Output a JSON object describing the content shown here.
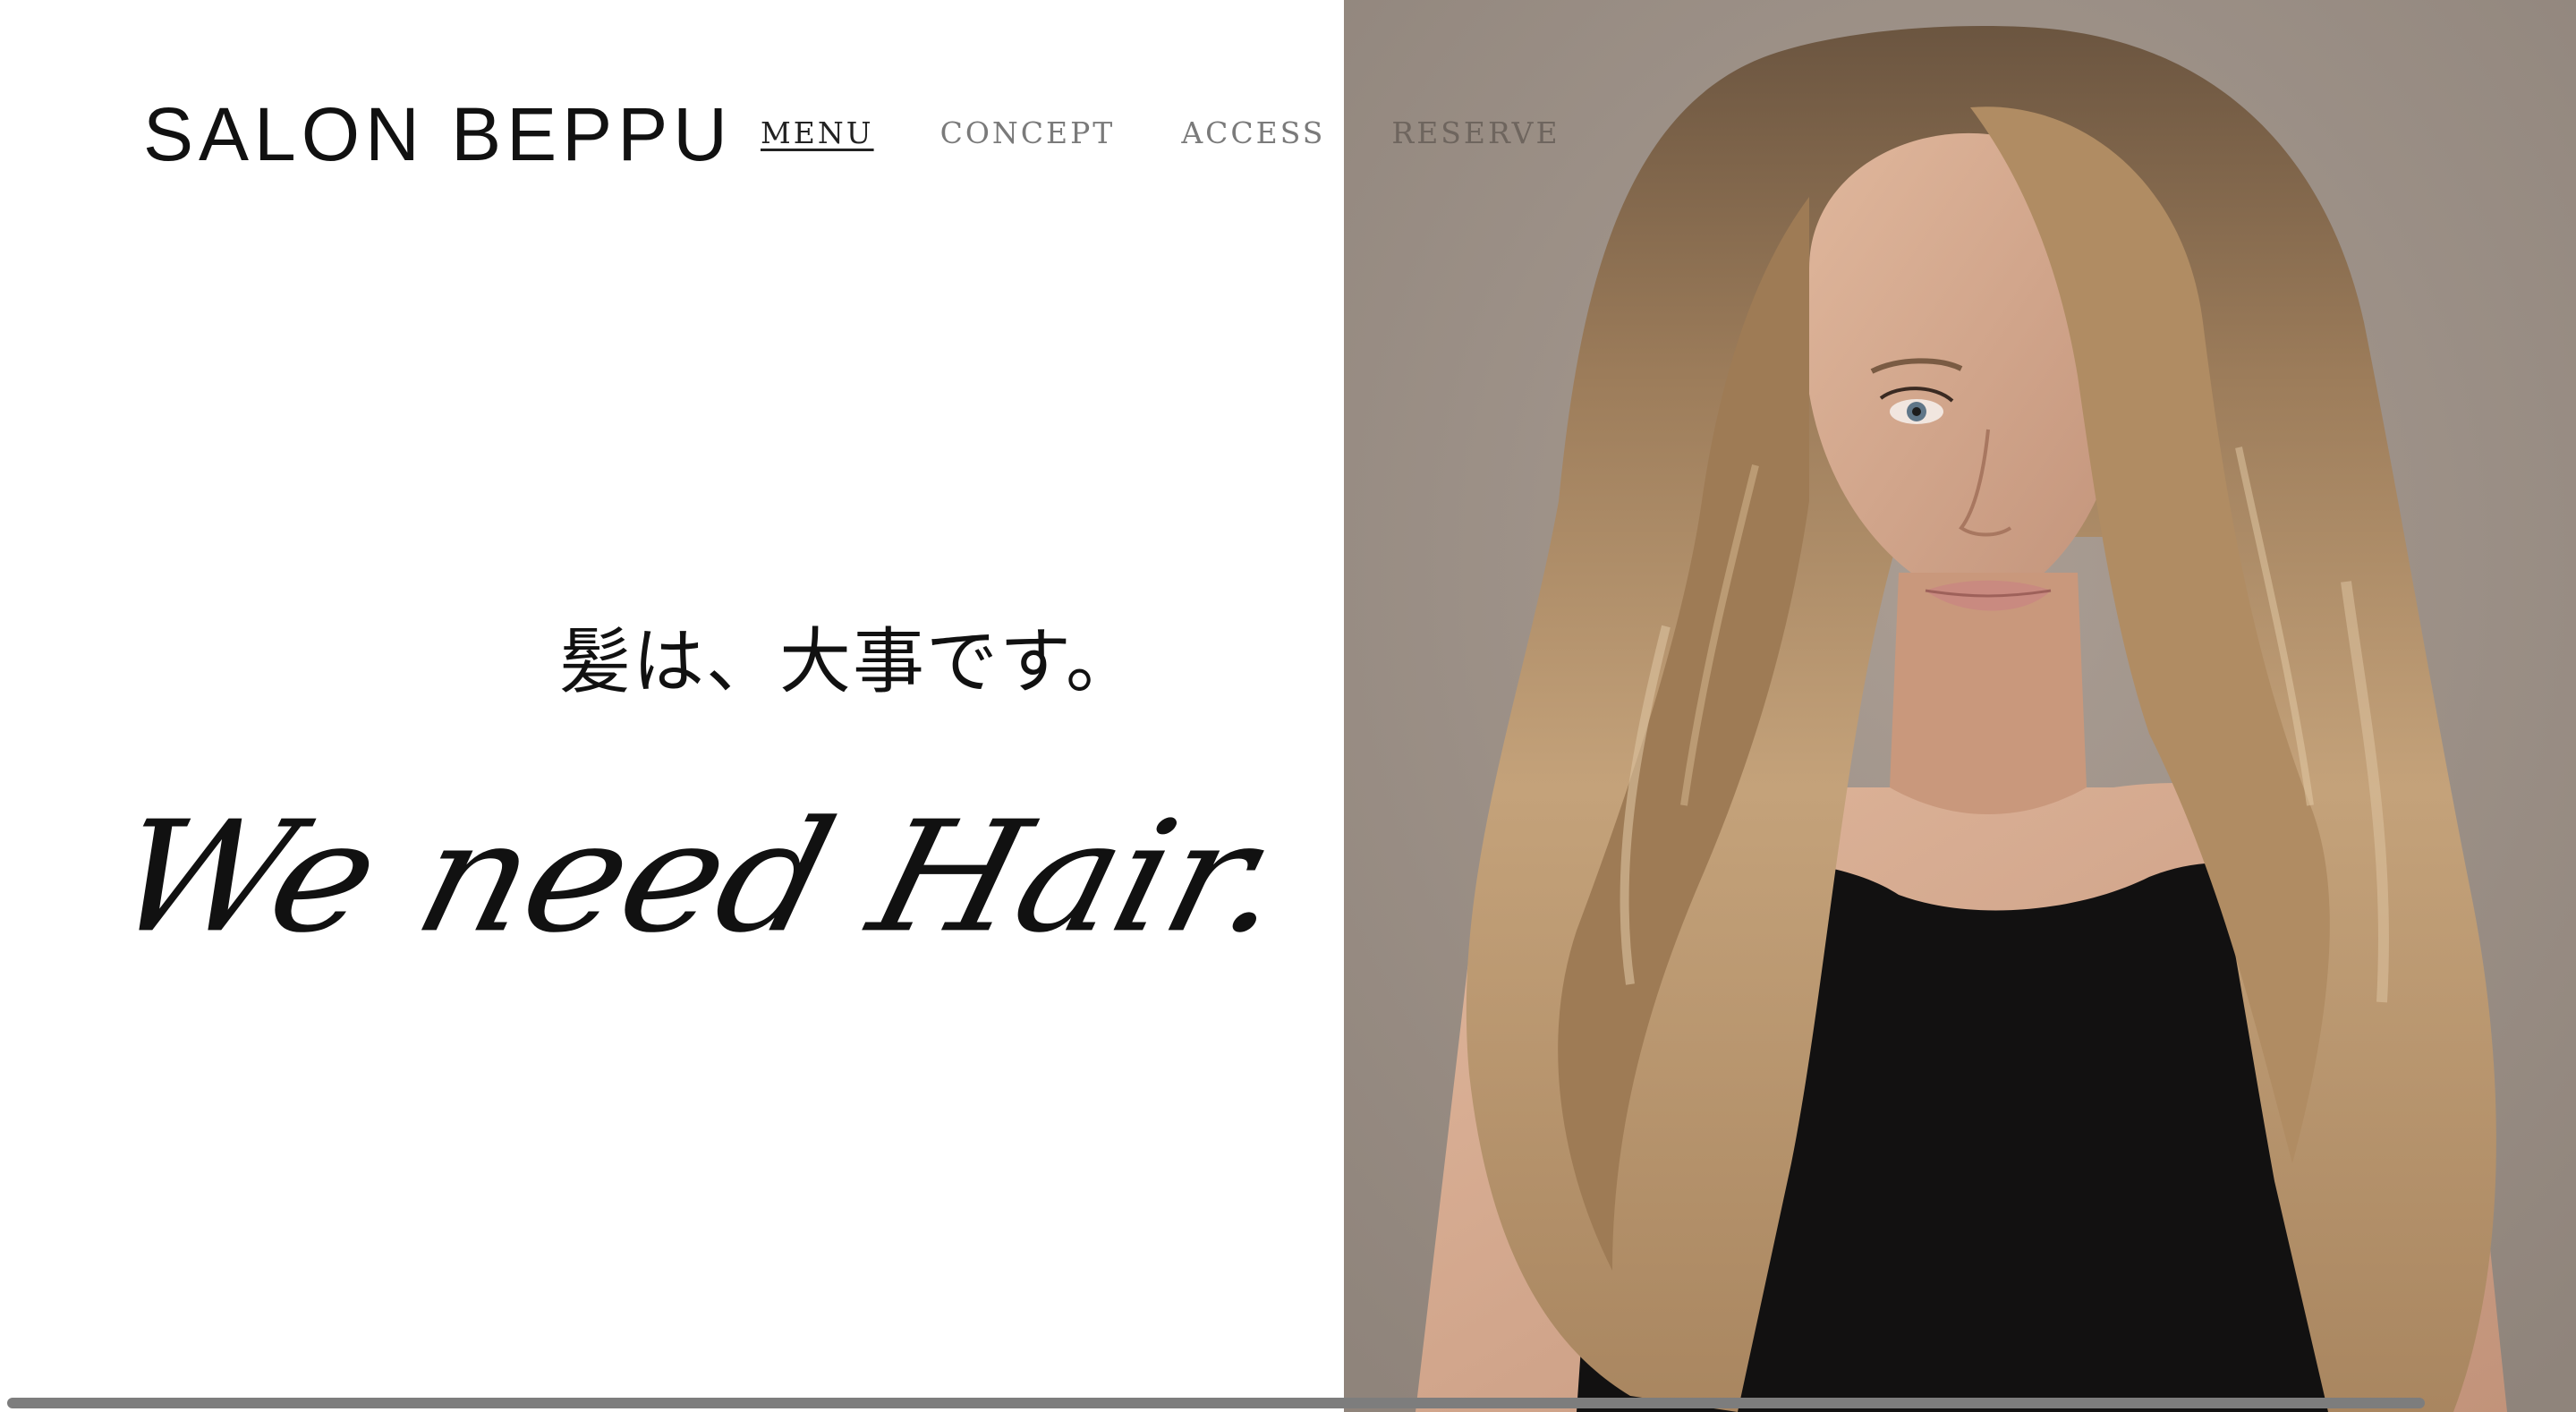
{
  "header": {
    "brand": "SALON BEPPU",
    "nav": [
      {
        "label": "MENU",
        "active": true
      },
      {
        "label": "CONCEPT",
        "active": false
      },
      {
        "label": "ACCESS",
        "active": false
      },
      {
        "label": "RESERVE",
        "active": false
      }
    ]
  },
  "hero": {
    "tagline_jp": "髪は、大事です。",
    "tagline_en": "We need Hair.",
    "photo_background": "#a0938a"
  }
}
